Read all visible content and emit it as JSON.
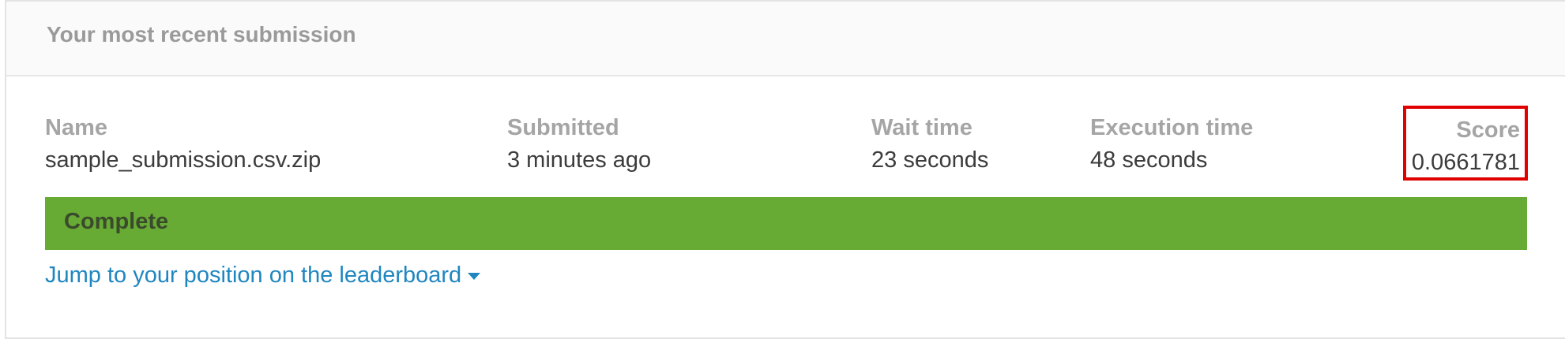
{
  "header": {
    "title": "Your most recent submission"
  },
  "submission": {
    "name_label": "Name",
    "name_value": "sample_submission.csv.zip",
    "submitted_label": "Submitted",
    "submitted_value": "3 minutes ago",
    "wait_label": "Wait time",
    "wait_value": "23 seconds",
    "exec_label": "Execution time",
    "exec_value": "48 seconds",
    "score_label": "Score",
    "score_value": "0.0661781"
  },
  "status": {
    "text": "Complete",
    "color": "#67ab34"
  },
  "leaderboard_link": {
    "text": "Jump to your position on the leaderboard",
    "icon": "caret-down-icon"
  },
  "highlight": {
    "color": "#e00000"
  }
}
